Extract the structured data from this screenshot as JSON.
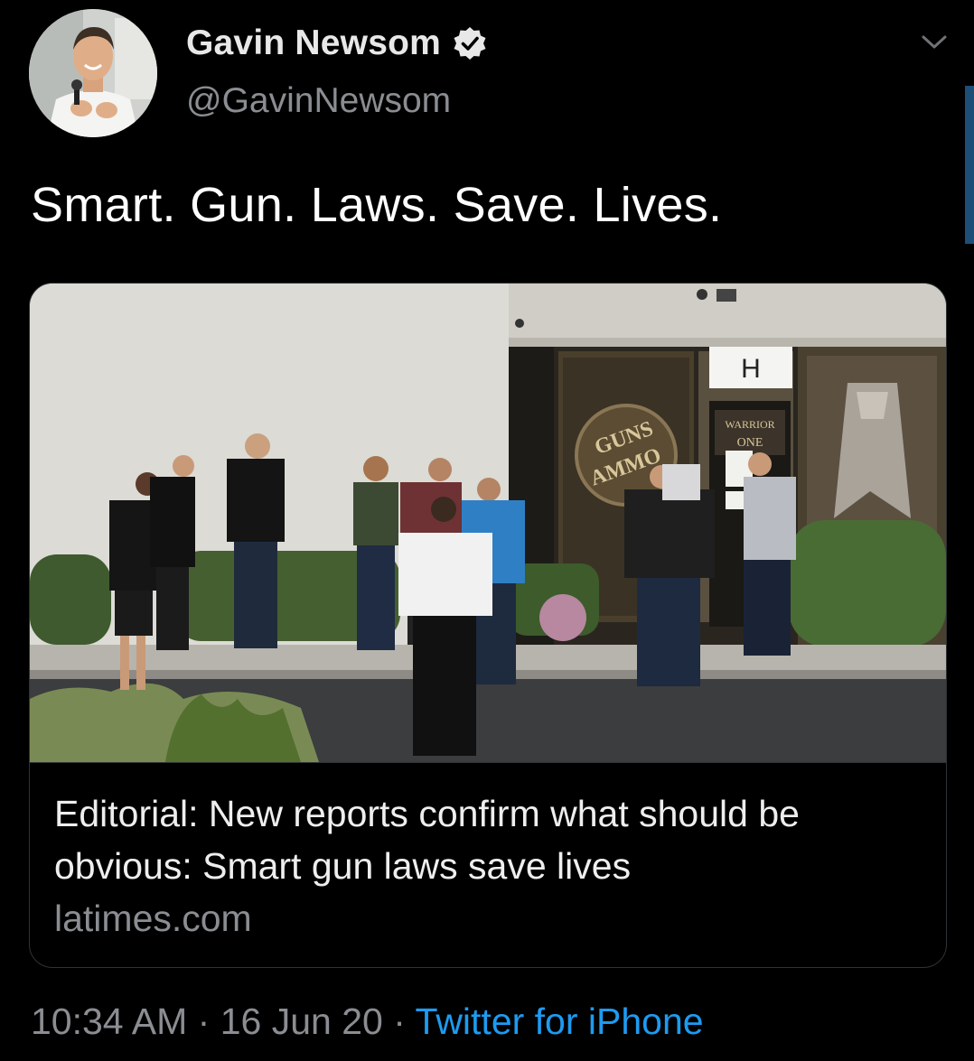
{
  "author": {
    "display_name": "Gavin Newsom",
    "handle": "@GavinNewsom",
    "verified": true,
    "avatar_icon": "profile-photo"
  },
  "tweet": {
    "text": "Smart. Gun. Laws. Save. Lives."
  },
  "link_card": {
    "image_signage": {
      "door_letter": "H",
      "store_sign_1": "GUNS",
      "store_sign_2": "AMMO",
      "door_sign_1": "WARRIOR",
      "door_sign_2": "ONE"
    },
    "title": "Editorial: New reports confirm what should be obvious: Smart gun laws save lives",
    "domain": "latimes.com"
  },
  "meta": {
    "time": "10:34 AM",
    "separator": "·",
    "date": "16 Jun 20",
    "source": "Twitter for iPhone"
  },
  "colors": {
    "background": "#000000",
    "secondary_text": "#8a8d91",
    "link": "#1d9bf0",
    "border": "#2f3336",
    "verified_badge": "#e8e8e8"
  }
}
